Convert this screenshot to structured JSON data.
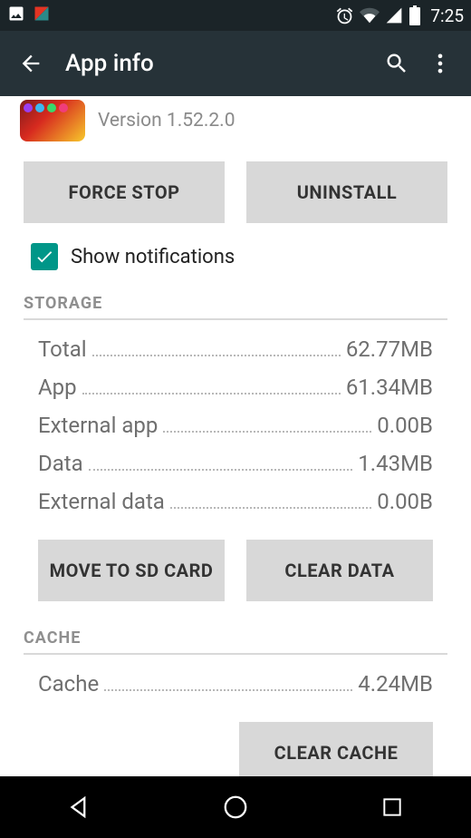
{
  "statusbar": {
    "time": "7:25"
  },
  "appbar": {
    "title": "App info"
  },
  "app": {
    "version": "Version 1.52.2.0"
  },
  "buttons": {
    "force_stop": "FORCE STOP",
    "uninstall": "UNINSTALL",
    "move_sd": "MOVE TO SD CARD",
    "clear_data": "CLEAR DATA",
    "clear_cache": "CLEAR CACHE"
  },
  "notifications": {
    "label": "Show notifications",
    "checked": true
  },
  "sections": {
    "storage": "STORAGE",
    "cache": "CACHE"
  },
  "storage": {
    "total": {
      "label": "Total",
      "value": "62.77MB"
    },
    "app": {
      "label": "App",
      "value": "61.34MB"
    },
    "external_app": {
      "label": "External app",
      "value": "0.00B"
    },
    "data": {
      "label": "Data",
      "value": "1.43MB"
    },
    "external_data": {
      "label": "External data",
      "value": "0.00B"
    }
  },
  "cache": {
    "cache": {
      "label": "Cache",
      "value": "4.24MB"
    }
  }
}
